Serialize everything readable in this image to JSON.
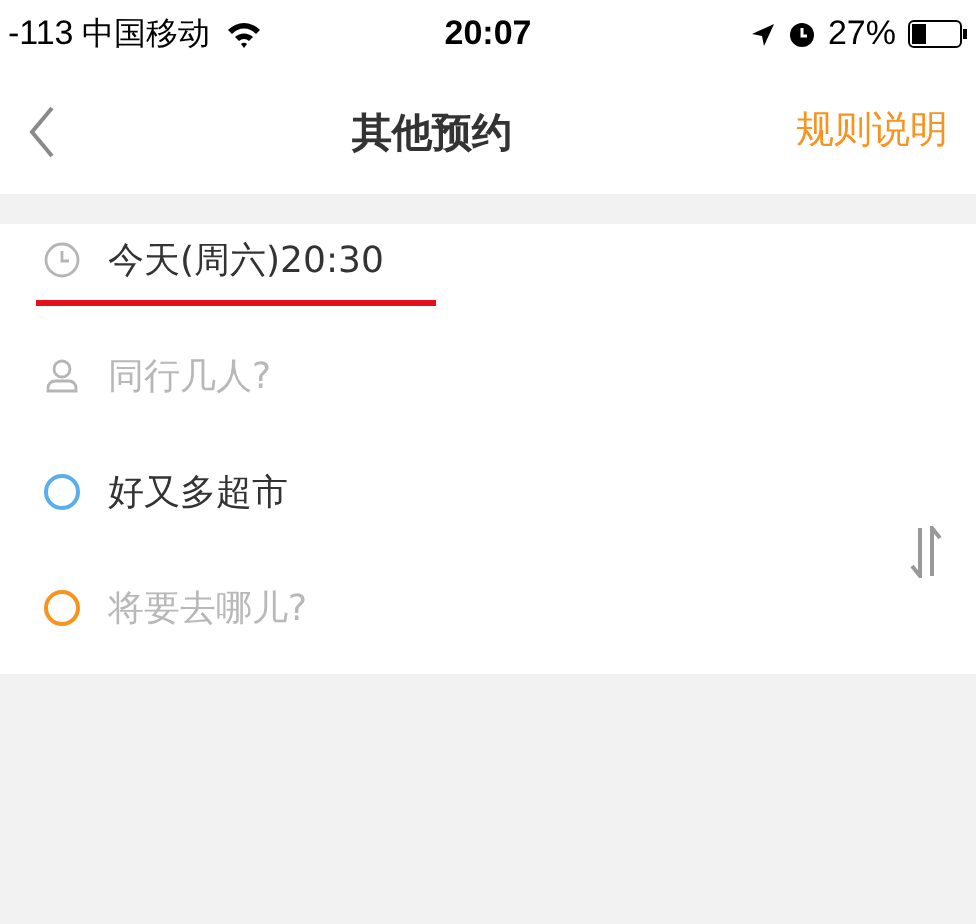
{
  "status_bar": {
    "signal": "-113",
    "carrier": "中国移动",
    "time": "20:07",
    "battery": "27%"
  },
  "nav": {
    "title": "其他预约",
    "action": "规则说明"
  },
  "rows": [
    {
      "kind": "time",
      "value": "今天(周六)20:30",
      "underlined": true
    },
    {
      "kind": "people",
      "placeholder": "同行几人?",
      "underlined": false
    },
    {
      "kind": "place",
      "value": "好又多超市",
      "color": "#5aaef0",
      "underlined": false
    },
    {
      "kind": "place",
      "placeholder": "将要去哪儿?",
      "color": "#f7931e",
      "underlined": false
    }
  ]
}
